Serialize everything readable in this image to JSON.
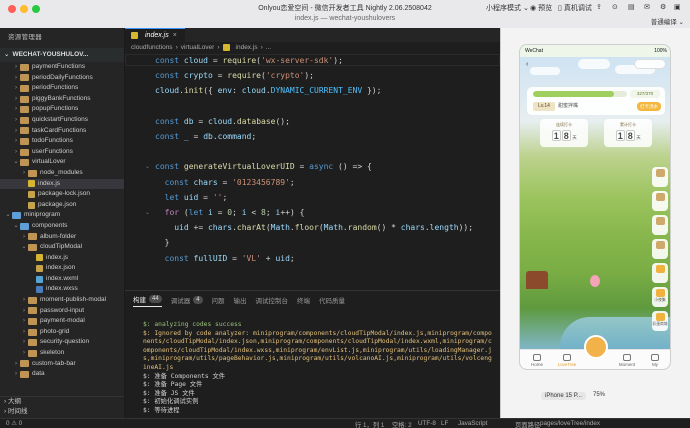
{
  "titlebar": {
    "app_title": "Onlyou恋爱空间 - 微信开发者工具 Nightly 2.06.2508042",
    "window_title": "index.js — wechat-youshulovers",
    "mode_label": "小程序模式",
    "preview_label": "预览",
    "real_debug_label": "真机调试",
    "sim_mode": "普通编译"
  },
  "sidebar": {
    "explorer_title": "资源管理器",
    "project_name": "WECHAT-YOUSHULOV...",
    "tree": [
      {
        "label": "paymentFunctions",
        "type": "folder",
        "depth": 1,
        "expanded": false
      },
      {
        "label": "periodDailyFunctions",
        "type": "folder",
        "depth": 1,
        "expanded": false
      },
      {
        "label": "periodFunctions",
        "type": "folder",
        "depth": 1,
        "expanded": false
      },
      {
        "label": "piggyBankFunctions",
        "type": "folder",
        "depth": 1,
        "expanded": false
      },
      {
        "label": "popupFunctions",
        "type": "folder",
        "depth": 1,
        "expanded": false
      },
      {
        "label": "quickstartFunctions",
        "type": "folder",
        "depth": 1,
        "expanded": false
      },
      {
        "label": "taskCardFunctions",
        "type": "folder",
        "depth": 1,
        "expanded": false
      },
      {
        "label": "todoFunctions",
        "type": "folder",
        "depth": 1,
        "expanded": false
      },
      {
        "label": "userFunctions",
        "type": "folder",
        "depth": 1,
        "expanded": false
      },
      {
        "label": "virtualLover",
        "type": "folder",
        "depth": 1,
        "expanded": true
      },
      {
        "label": "node_modules",
        "type": "folder",
        "depth": 2,
        "expanded": false
      },
      {
        "label": "index.js",
        "type": "js",
        "depth": 2,
        "active": true
      },
      {
        "label": "package-lock.json",
        "type": "json",
        "depth": 2
      },
      {
        "label": "package.json",
        "type": "json",
        "depth": 2
      },
      {
        "label": "miniprogram",
        "type": "folder-blue",
        "depth": 0,
        "expanded": true
      },
      {
        "label": "components",
        "type": "folder-blue",
        "depth": 1,
        "expanded": true
      },
      {
        "label": "album-folder",
        "type": "folder",
        "depth": 2,
        "expanded": false
      },
      {
        "label": "cloudTipModal",
        "type": "folder",
        "depth": 2,
        "expanded": true
      },
      {
        "label": "index.js",
        "type": "js",
        "depth": 3
      },
      {
        "label": "index.json",
        "type": "json",
        "depth": 3
      },
      {
        "label": "index.wxml",
        "type": "wxml",
        "depth": 3
      },
      {
        "label": "index.wxss",
        "type": "wxss",
        "depth": 3
      },
      {
        "label": "moment-publish-modal",
        "type": "folder",
        "depth": 2,
        "expanded": false
      },
      {
        "label": "password-input",
        "type": "folder",
        "depth": 2,
        "expanded": false
      },
      {
        "label": "payment-modal",
        "type": "folder",
        "depth": 2,
        "expanded": false
      },
      {
        "label": "photo-grid",
        "type": "folder",
        "depth": 2,
        "expanded": false
      },
      {
        "label": "security-question",
        "type": "folder",
        "depth": 2,
        "expanded": false
      },
      {
        "label": "skeleton",
        "type": "folder",
        "depth": 2,
        "expanded": false
      },
      {
        "label": "custom-tab-bar",
        "type": "folder",
        "depth": 1,
        "expanded": false
      },
      {
        "label": "data",
        "type": "folder",
        "depth": 1,
        "expanded": false
      }
    ],
    "outline_label": "大纲",
    "timeline_label": "时间线"
  },
  "editor": {
    "tab_label": "index.js",
    "breadcrumb": [
      "cloudfunctions",
      "virtualLover",
      "index.js",
      "..."
    ],
    "lines": [
      [
        {
          "t": "kw",
          "v": "const "
        },
        {
          "t": "var",
          "v": "cloud"
        },
        {
          "t": "p",
          "v": " = "
        },
        {
          "t": "fn",
          "v": "require"
        },
        {
          "t": "p",
          "v": "("
        },
        {
          "t": "str",
          "v": "'wx-server-sdk'"
        },
        {
          "t": "p",
          "v": ");"
        }
      ],
      [
        {
          "t": "kw",
          "v": "const "
        },
        {
          "t": "var",
          "v": "crypto"
        },
        {
          "t": "p",
          "v": " = "
        },
        {
          "t": "fn",
          "v": "require"
        },
        {
          "t": "p",
          "v": "("
        },
        {
          "t": "str",
          "v": "'crypto'"
        },
        {
          "t": "p",
          "v": ");"
        }
      ],
      [
        {
          "t": "var",
          "v": "cloud"
        },
        {
          "t": "p",
          "v": "."
        },
        {
          "t": "fn",
          "v": "init"
        },
        {
          "t": "p",
          "v": "({ "
        },
        {
          "t": "var",
          "v": "env"
        },
        {
          "t": "p",
          "v": ": "
        },
        {
          "t": "var",
          "v": "cloud"
        },
        {
          "t": "p",
          "v": "."
        },
        {
          "t": "cst",
          "v": "DYNAMIC_CURRENT_ENV"
        },
        {
          "t": "p",
          "v": " });"
        }
      ],
      [],
      [
        {
          "t": "kw",
          "v": "const "
        },
        {
          "t": "var",
          "v": "db"
        },
        {
          "t": "p",
          "v": " = "
        },
        {
          "t": "var",
          "v": "cloud"
        },
        {
          "t": "p",
          "v": "."
        },
        {
          "t": "fn",
          "v": "database"
        },
        {
          "t": "p",
          "v": "();"
        }
      ],
      [
        {
          "t": "kw",
          "v": "const "
        },
        {
          "t": "var",
          "v": "_"
        },
        {
          "t": "p",
          "v": " = "
        },
        {
          "t": "var",
          "v": "db"
        },
        {
          "t": "p",
          "v": "."
        },
        {
          "t": "var",
          "v": "command"
        },
        {
          "t": "p",
          "v": ";"
        }
      ],
      [],
      [
        {
          "t": "kw",
          "v": "const "
        },
        {
          "t": "fn",
          "v": "generateVirtualLoverUID"
        },
        {
          "t": "p",
          "v": " = "
        },
        {
          "t": "kw",
          "v": "async "
        },
        {
          "t": "p",
          "v": "() => {"
        }
      ],
      [
        {
          "t": "p",
          "v": "  "
        },
        {
          "t": "kw",
          "v": "const "
        },
        {
          "t": "var",
          "v": "chars"
        },
        {
          "t": "p",
          "v": " = "
        },
        {
          "t": "str",
          "v": "'0123456789'"
        },
        {
          "t": "p",
          "v": ";"
        }
      ],
      [
        {
          "t": "p",
          "v": "  "
        },
        {
          "t": "kw",
          "v": "let "
        },
        {
          "t": "var",
          "v": "uid"
        },
        {
          "t": "p",
          "v": " = "
        },
        {
          "t": "str",
          "v": "''"
        },
        {
          "t": "p",
          "v": ";"
        }
      ],
      [
        {
          "t": "p",
          "v": "  "
        },
        {
          "t": "kw2",
          "v": "for "
        },
        {
          "t": "p",
          "v": "("
        },
        {
          "t": "kw",
          "v": "let "
        },
        {
          "t": "var",
          "v": "i"
        },
        {
          "t": "p",
          "v": " = "
        },
        {
          "t": "num",
          "v": "0"
        },
        {
          "t": "p",
          "v": "; "
        },
        {
          "t": "var",
          "v": "i"
        },
        {
          "t": "p",
          "v": " < "
        },
        {
          "t": "num",
          "v": "8"
        },
        {
          "t": "p",
          "v": "; "
        },
        {
          "t": "var",
          "v": "i"
        },
        {
          "t": "p",
          "v": "++) {"
        }
      ],
      [
        {
          "t": "p",
          "v": "    "
        },
        {
          "t": "var",
          "v": "uid"
        },
        {
          "t": "p",
          "v": " += "
        },
        {
          "t": "var",
          "v": "chars"
        },
        {
          "t": "p",
          "v": "."
        },
        {
          "t": "fn",
          "v": "charAt"
        },
        {
          "t": "p",
          "v": "("
        },
        {
          "t": "var",
          "v": "Math"
        },
        {
          "t": "p",
          "v": "."
        },
        {
          "t": "fn",
          "v": "floor"
        },
        {
          "t": "p",
          "v": "("
        },
        {
          "t": "var",
          "v": "Math"
        },
        {
          "t": "p",
          "v": "."
        },
        {
          "t": "fn",
          "v": "random"
        },
        {
          "t": "p",
          "v": "() * "
        },
        {
          "t": "var",
          "v": "chars"
        },
        {
          "t": "p",
          "v": "."
        },
        {
          "t": "var",
          "v": "length"
        },
        {
          "t": "p",
          "v": "));"
        }
      ],
      [
        {
          "t": "p",
          "v": "  }"
        }
      ],
      [
        {
          "t": "p",
          "v": "  "
        },
        {
          "t": "kw",
          "v": "const "
        },
        {
          "t": "var",
          "v": "fullUID"
        },
        {
          "t": "p",
          "v": " = "
        },
        {
          "t": "str",
          "v": "'VL'"
        },
        {
          "t": "p",
          "v": " + "
        },
        {
          "t": "var",
          "v": "uid"
        },
        {
          "t": "p",
          "v": ";"
        }
      ]
    ]
  },
  "panel": {
    "tabs": [
      {
        "label": "构建",
        "badge": "44",
        "active": true
      },
      {
        "label": "调试器",
        "badge": "4"
      },
      {
        "label": "问题"
      },
      {
        "label": "输出"
      },
      {
        "label": "调试控制台"
      },
      {
        "label": "终端"
      },
      {
        "label": "代码质量"
      }
    ],
    "console": [
      {
        "c": "g",
        "v": "$: analyzing codes success"
      },
      {
        "c": "y",
        "v": "$: Ignored by code analyzer: miniprogram/components/cloudTipModal/index.js,miniprogram/components/cloudTipModal/index.json,miniprogram/components/cloudTipModal/index.wxml,miniprogram/components/cloudTipModal/index.wxss,miniprogram/envList.js,miniprogram/utils/loadingManager.js,miniprogram/utils/pageBehavior.js,miniprogram/utils/volcanoAI.js,miniprogram/utils/volcengineAI.js"
      },
      {
        "c": "n",
        "v": "$: 准备 Components 文件"
      },
      {
        "c": "n",
        "v": "$: 准备 Page 文件"
      },
      {
        "c": "n",
        "v": "$: 准备 JS 文件"
      },
      {
        "c": "n",
        "v": "$: 初始化调试实例"
      },
      {
        "c": "n",
        "v": "$: 等待进程"
      }
    ]
  },
  "statusbar": {
    "branch": "0 ⚠ 0",
    "position": "行 1，列 1",
    "spaces": "空格: 2",
    "encoding": "UTF-8",
    "eol": "LF",
    "language": "JavaScript",
    "page_path_label": "页面路径",
    "page_path": "pages/loveTree/index"
  },
  "simulator": {
    "status_time": "WeChat",
    "battery": "100%",
    "progress_value": 0.86,
    "progress_text": "327/370",
    "level_label": "Lv.14",
    "level_name": "甜蜜拌嘴",
    "daily_btn": "打卡浇水",
    "stat1_label": "连续打卡",
    "stat1_digits": [
      "1",
      "8"
    ],
    "stat1_unit": "天",
    "stat2_label": "累计打卡",
    "stat2_digits": [
      "1",
      "8"
    ],
    "stat2_unit": "天",
    "side_buttons": [
      "",
      "",
      "",
      "",
      "",
      "小夜集",
      "彩蛋商城"
    ],
    "tab_items": [
      "Home",
      "LoveTree",
      "",
      "Moment",
      "My"
    ],
    "device": "iPhone 15 P...",
    "zoom": "75%"
  }
}
